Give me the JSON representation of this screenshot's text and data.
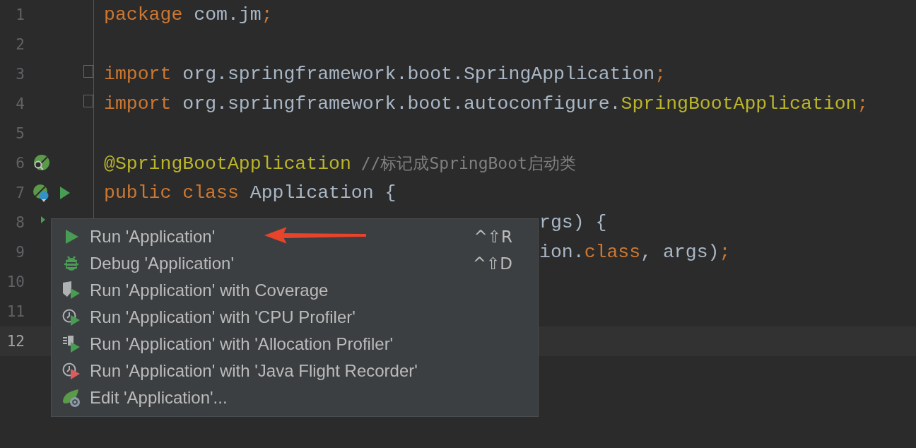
{
  "editor": {
    "lines": [
      {
        "number": "1",
        "current": false,
        "fold": false,
        "tokens": [
          {
            "text": "package",
            "kind": "keyword"
          },
          {
            "text": " com.jm",
            "kind": "plain"
          },
          {
            "text": ";",
            "kind": "keyword"
          }
        ]
      },
      {
        "number": "2",
        "current": false,
        "fold": false
      },
      {
        "number": "3",
        "current": false,
        "fold": true,
        "tokens": [
          {
            "text": "import",
            "kind": "keyword"
          },
          {
            "text": " org.springframework.boot.SpringApplication",
            "kind": "plain"
          },
          {
            "text": ";",
            "kind": "keyword"
          }
        ]
      },
      {
        "number": "4",
        "current": false,
        "fold": true,
        "tokens": [
          {
            "text": "import",
            "kind": "keyword"
          },
          {
            "text": " org.springframework.boot.autoconfigure.",
            "kind": "plain"
          },
          {
            "text": "SpringBootApplication",
            "kind": "annotation"
          },
          {
            "text": ";",
            "kind": "keyword"
          }
        ]
      },
      {
        "number": "5",
        "current": false,
        "fold": false
      },
      {
        "number": "6",
        "current": false,
        "fold": false,
        "markers": [
          {
            "kind": "leaf-search"
          }
        ],
        "tokens": [
          {
            "text": "@SpringBootApplication",
            "kind": "annotation"
          },
          {
            "text": " //标记成SpringBoot启动类",
            "kind": "comment"
          }
        ]
      },
      {
        "number": "7",
        "current": false,
        "fold": false,
        "markers": [
          {
            "kind": "leaf-class"
          },
          {
            "kind": "run"
          }
        ],
        "tokens": [
          {
            "text": "public class",
            "kind": "keyword"
          },
          {
            "text": " Application {",
            "kind": "plain"
          }
        ]
      },
      {
        "number": "8",
        "current": false,
        "partial": true,
        "markers": [
          {
            "kind": "run-small"
          }
        ],
        "tokens": [
          {
            "text": "rgs) {",
            "kind": "plain"
          }
        ]
      },
      {
        "number": "9",
        "current": false,
        "partial": true,
        "tokens": [
          {
            "text": "ion.",
            "kind": "plain"
          },
          {
            "text": "class",
            "kind": "keyword"
          },
          {
            "text": ", args)",
            "kind": "plain"
          },
          {
            "text": ";",
            "kind": "keyword"
          }
        ]
      },
      {
        "number": "10",
        "current": false
      },
      {
        "number": "11",
        "current": false
      },
      {
        "number": "12",
        "current": true
      }
    ]
  },
  "popup": {
    "items": [
      {
        "kind": "run",
        "label": "Run 'Application'",
        "shortcut": "^⇧R"
      },
      {
        "kind": "debug",
        "label": "Debug 'Application'",
        "shortcut": "^⇧D"
      },
      {
        "kind": "coverage",
        "label": "Run 'Application' with Coverage"
      },
      {
        "kind": "cpu",
        "label": "Run 'Application' with 'CPU Profiler'"
      },
      {
        "kind": "allocation",
        "label": "Run 'Application' with 'Allocation Profiler'"
      },
      {
        "kind": "jfr",
        "label": "Run 'Application' with 'Java Flight Recorder'"
      },
      {
        "kind": "edit",
        "label": "Edit 'Application'..."
      }
    ]
  }
}
